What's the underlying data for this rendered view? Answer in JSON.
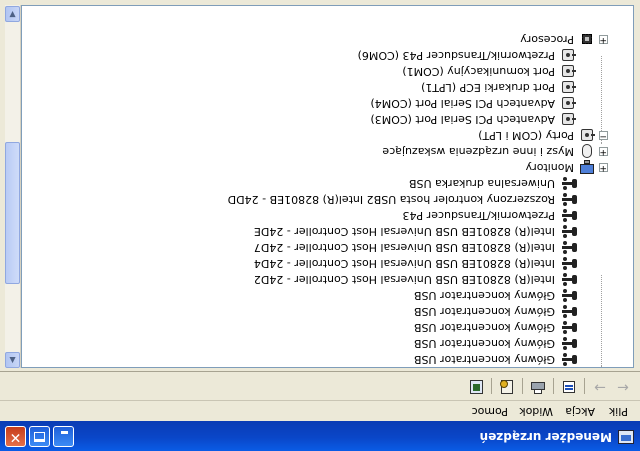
{
  "window": {
    "title": "Menedżer urządzeń"
  },
  "menu": {
    "items": [
      "Plik",
      "Akcja",
      "Widok",
      "Pomoc"
    ]
  },
  "toolbar": {
    "buttons": [
      "back-arrow-icon",
      "forward-arrow-icon",
      "properties-icon",
      "print-icon",
      "scan-hardware-icon",
      "update-driver-icon"
    ]
  },
  "tree": {
    "usb_items": [
      "Główny koncentrator USB",
      "Główny koncentrator USB",
      "Główny koncentrator USB",
      "Główny koncentrator USB",
      "Główny koncentrator USB",
      "Intel(R) 82801EB USB Universal Host Controller - 24D2",
      "Intel(R) 82801EB USB Universal Host Controller - 24D4",
      "Intel(R) 82801EB USB Universal Host Controller - 24D7",
      "Intel(R) 82801EB USB Universal Host Controller - 24DE",
      "Przetwornik/Transducer P43",
      "Rozszerzony kontroler hosta USB2 Intel(R) 82801EB - 24DD",
      "Uniwersalna drukarka USB"
    ],
    "categories": {
      "monitors": "Monitory",
      "mice": "Mysz i inne urządzenia wskazujące",
      "ports": "Porty (COM i LPT)",
      "processors": "Procesory"
    },
    "port_items": [
      "Advantech PCI Serial Port (COM3)",
      "Advantech PCI Serial Port (COM4)",
      "Port drukarki ECP (LPT1)",
      "Port komunikacyjny (COM1)",
      "Przetwornik/Transducer P43 (COM6)"
    ]
  }
}
